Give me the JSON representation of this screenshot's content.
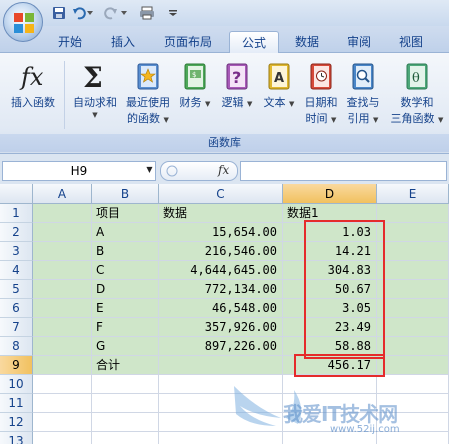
{
  "ribbon_tabs": [
    "开始",
    "插入",
    "页面布局",
    "公式",
    "数据",
    "审阅",
    "视图"
  ],
  "active_tab": "公式",
  "ribbon_buttons": [
    {
      "label": "插入函数",
      "label2": "",
      "icon": "fx-icon"
    },
    {
      "label": "自动求和",
      "label2": "",
      "icon": "sigma-icon"
    },
    {
      "label": "最近使用",
      "label2": "的函数",
      "icon": "star-book-icon"
    },
    {
      "label": "财务",
      "label2": "",
      "icon": "finance-book-icon"
    },
    {
      "label": "逻辑",
      "label2": "",
      "icon": "logic-book-icon"
    },
    {
      "label": "文本",
      "label2": "",
      "icon": "text-book-icon"
    },
    {
      "label": "日期和",
      "label2": "时间",
      "icon": "datetime-book-icon"
    },
    {
      "label": "查找与",
      "label2": "引用",
      "icon": "lookup-book-icon"
    },
    {
      "label": "数学和",
      "label2": "三角函数",
      "icon": "math-book-icon"
    }
  ],
  "ribbon_group_caption": "函数库",
  "name_box": "H9",
  "fx_label": "fx",
  "columns": [
    "A",
    "B",
    "C",
    "D",
    "E"
  ],
  "selected_column": "D",
  "selected_row": "9",
  "rows": [
    {
      "num": "1",
      "b": "项目",
      "c": "数据",
      "d": "数据1"
    },
    {
      "num": "2",
      "b": "A",
      "c": "15,654.00",
      "d": "1.03"
    },
    {
      "num": "3",
      "b": "B",
      "c": "216,546.00",
      "d": "14.21"
    },
    {
      "num": "4",
      "b": "C",
      "c": "4,644,645.00",
      "d": "304.83"
    },
    {
      "num": "5",
      "b": "D",
      "c": "772,134.00",
      "d": "50.67"
    },
    {
      "num": "6",
      "b": "E",
      "c": "46,548.00",
      "d": "3.05"
    },
    {
      "num": "7",
      "b": "F",
      "c": "357,926.00",
      "d": "23.49"
    },
    {
      "num": "8",
      "b": "G",
      "c": "897,226.00",
      "d": "58.88"
    },
    {
      "num": "9",
      "b": "合计",
      "c": "",
      "d": "456.17"
    },
    {
      "num": "10",
      "b": "",
      "c": "",
      "d": ""
    },
    {
      "num": "11",
      "b": "",
      "c": "",
      "d": ""
    },
    {
      "num": "12",
      "b": "",
      "c": "",
      "d": ""
    },
    {
      "num": "13",
      "b": "",
      "c": "",
      "d": ""
    }
  ],
  "watermark": {
    "text": "我爱IT技术网",
    "url": "www.52ij.com"
  },
  "colors": {
    "highlight_red": "#e52b2b",
    "cell_green": "#cfe6c9",
    "header_selected": "#f1c15f"
  }
}
